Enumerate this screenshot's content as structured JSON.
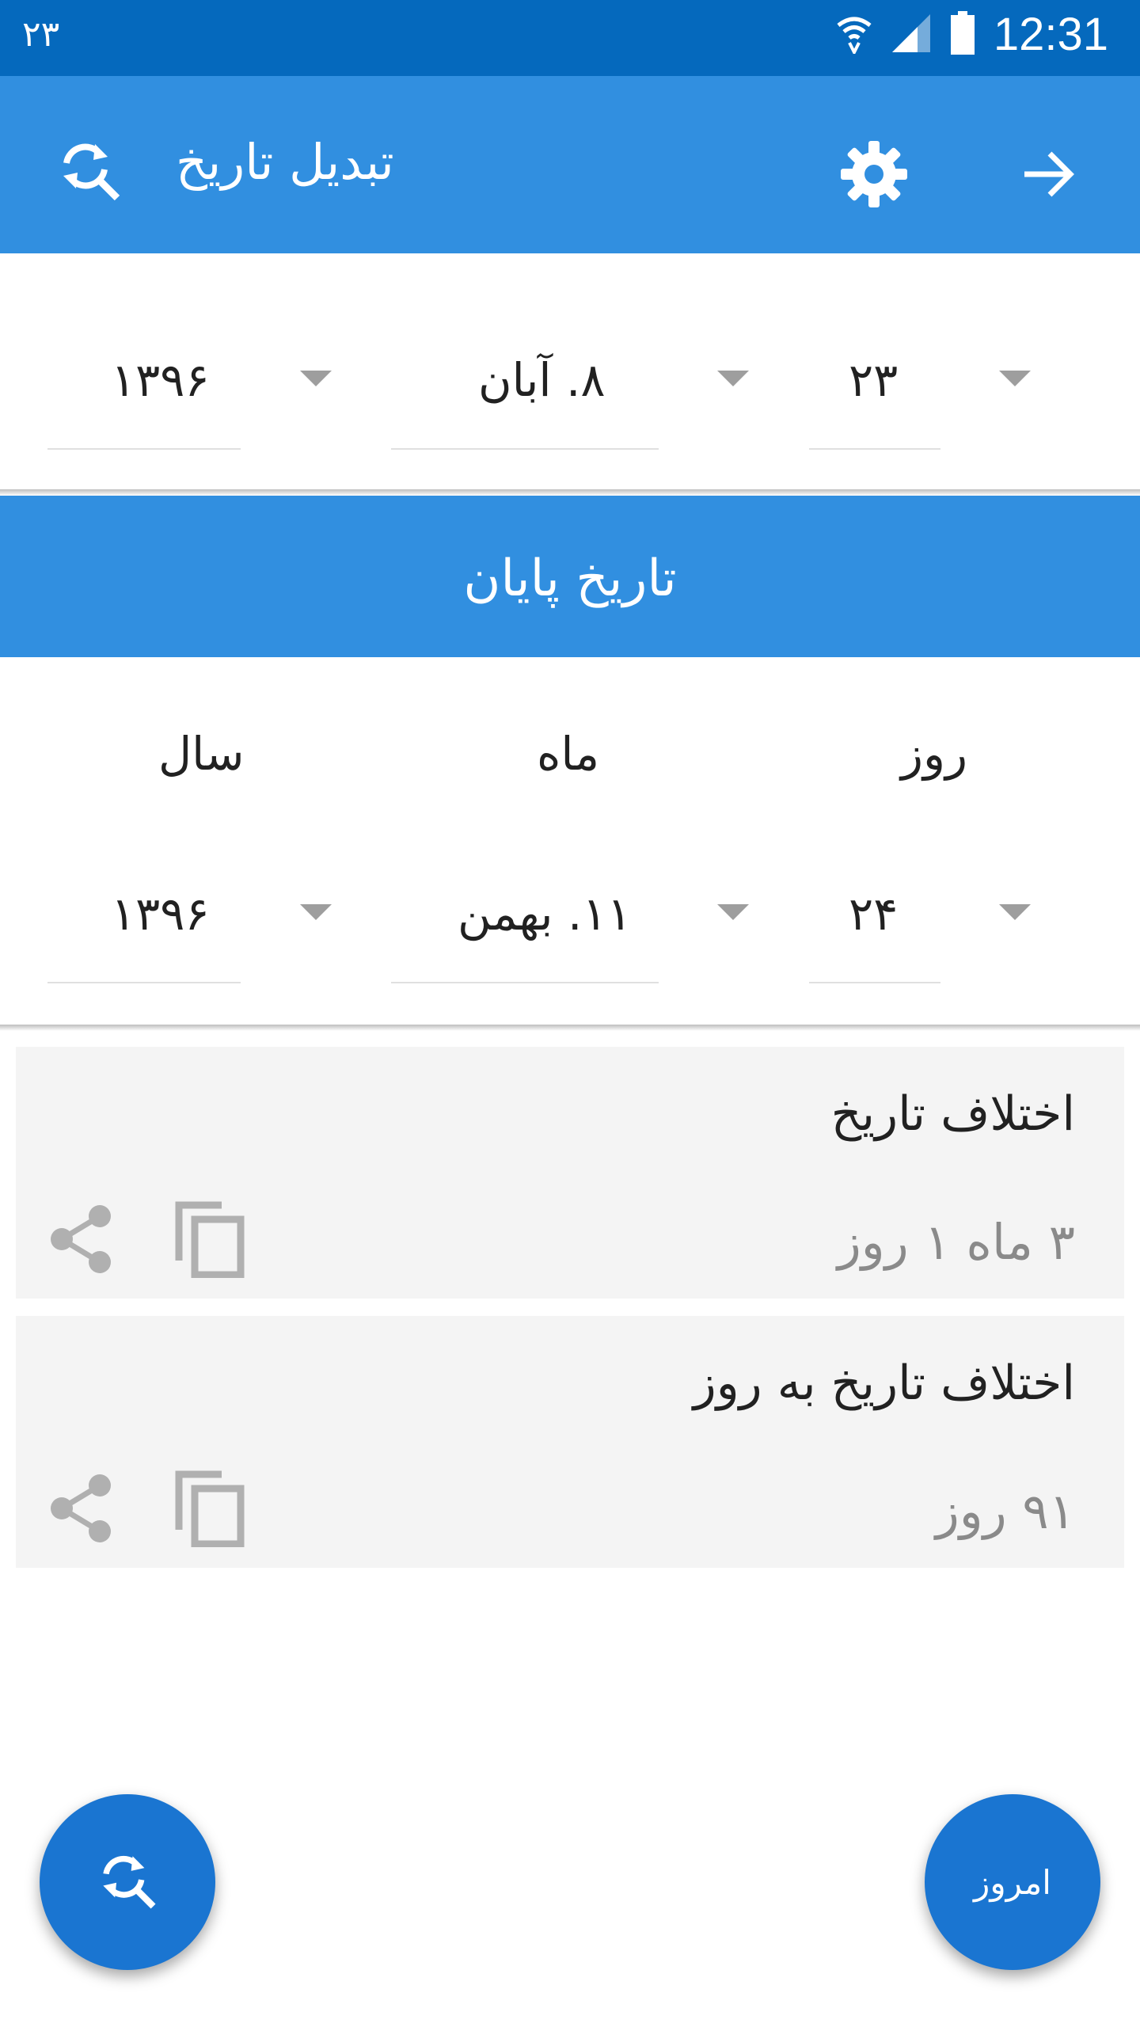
{
  "status_bar": {
    "left_text": "۲۳",
    "time": "12:31",
    "icons": [
      "wifi-icon",
      "signal-icon",
      "battery-icon"
    ]
  },
  "app_bar": {
    "title": "تبدیل تاریخ",
    "icons": [
      "sync-search-icon",
      "gear-icon",
      "arrow-forward-icon"
    ]
  },
  "start_date": {
    "day": "۲۳",
    "month": "۸. آبان",
    "year": "۱۳۹۶"
  },
  "end_section": {
    "title": "تاریخ پایان"
  },
  "labels": {
    "day": "روز",
    "month": "ماه",
    "year": "سال"
  },
  "end_date": {
    "day": "۲۴",
    "month": "۱۱. بهمن",
    "year": "۱۳۹۶"
  },
  "results": [
    {
      "title": "اختلاف تاریخ",
      "value": "۳ ماه ۱ روز"
    },
    {
      "title": "اختلاف تاریخ به روز",
      "value": "۹۱ روز"
    }
  ],
  "fab": {
    "today_label": "امروز"
  },
  "colors": {
    "status_bar": "#0569bd",
    "primary": "#318fe0",
    "fab": "#1a75d1",
    "card_bg": "#f4f4f4",
    "muted_text": "#8a8a8a"
  }
}
